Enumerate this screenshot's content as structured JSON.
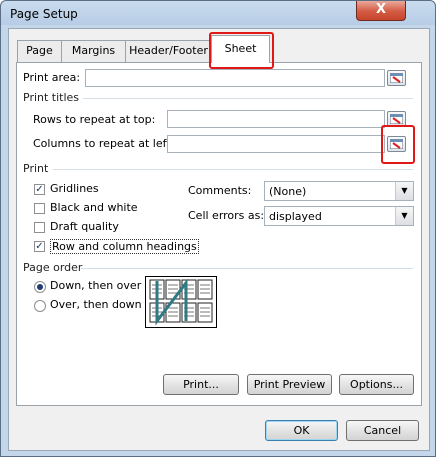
{
  "window": {
    "title": "Page Setup",
    "close_label": "X"
  },
  "tabs": [
    {
      "label": "Page"
    },
    {
      "label": "Margins"
    },
    {
      "label": "Header/Footer"
    },
    {
      "label": "Sheet",
      "active": true
    }
  ],
  "print_area": {
    "label": "Print area:",
    "value": ""
  },
  "print_titles": {
    "group_label": "Print titles",
    "rows_label": "Rows to repeat at top:",
    "rows_value": "",
    "columns_label": "Columns to repeat at left:",
    "columns_value": ""
  },
  "print": {
    "group_label": "Print",
    "gridlines": {
      "label": "Gridlines",
      "checked": true
    },
    "black_and_white": {
      "label": "Black and white",
      "checked": false
    },
    "draft_quality": {
      "label": "Draft quality",
      "checked": false
    },
    "row_col_headings": {
      "label": "Row and column headings",
      "checked": true
    },
    "comments_label": "Comments:",
    "comments_value": "(None)",
    "cell_errors_label": "Cell errors as:",
    "cell_errors_value": "displayed"
  },
  "page_order": {
    "group_label": "Page order",
    "down_then_over": {
      "label": "Down, then over",
      "selected": true
    },
    "over_then_down": {
      "label": "Over, then down",
      "selected": false
    }
  },
  "buttons": {
    "print": "Print...",
    "print_preview": "Print Preview",
    "options": "Options...",
    "ok": "OK",
    "cancel": "Cancel"
  },
  "colors": {
    "highlight": "#e01818",
    "accent": "#1c3b73",
    "preview_arrow": "#2f7a83"
  },
  "icons": {
    "ref_button": "collapse-dialog-icon",
    "dropdown": "chevron-down-icon"
  }
}
